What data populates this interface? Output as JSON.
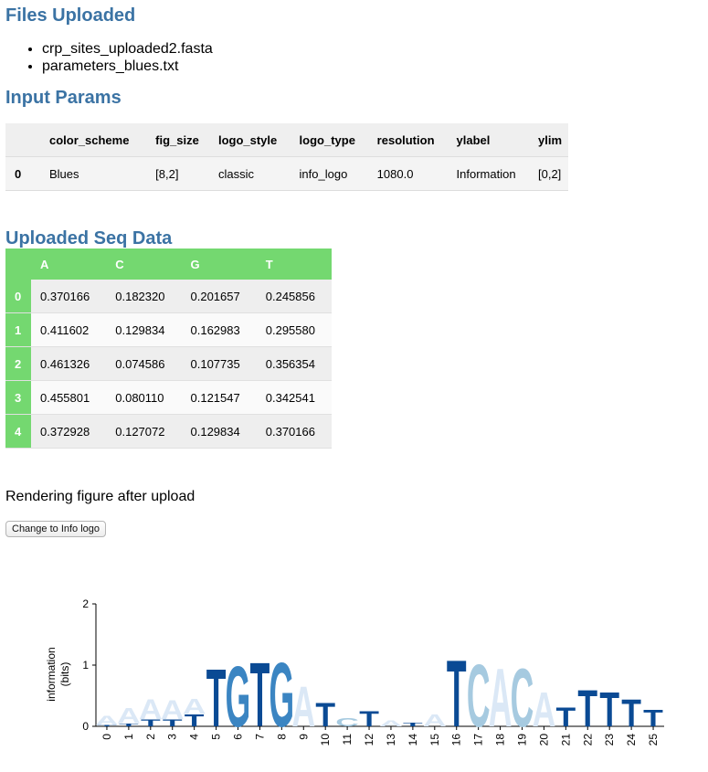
{
  "files": {
    "title": "Files Uploaded",
    "items": [
      "crp_sites_uploaded2.fasta",
      "parameters_blues.txt"
    ]
  },
  "params": {
    "title": "Input Params",
    "headers": [
      "",
      "color_scheme",
      "fig_size",
      "logo_style",
      "logo_type",
      "resolution",
      "ylabel",
      "ylim"
    ],
    "rows": [
      [
        "0",
        "Blues",
        "[8,2]",
        "classic",
        "info_logo",
        "1080.0",
        "Information",
        "[0,2]"
      ]
    ]
  },
  "seq": {
    "title": "Uploaded Seq Data",
    "headers": [
      "",
      "A",
      "C",
      "G",
      "T"
    ],
    "rows": [
      [
        "0",
        "0.370166",
        "0.182320",
        "0.201657",
        "0.245856"
      ],
      [
        "1",
        "0.411602",
        "0.129834",
        "0.162983",
        "0.295580"
      ],
      [
        "2",
        "0.461326",
        "0.074586",
        "0.107735",
        "0.356354"
      ],
      [
        "3",
        "0.455801",
        "0.080110",
        "0.121547",
        "0.342541"
      ],
      [
        "4",
        "0.372928",
        "0.127072",
        "0.129834",
        "0.370166"
      ]
    ]
  },
  "render_text": "Rendering figure after upload",
  "button_label": "Change to Info logo",
  "chart_data": {
    "type": "sequence-logo",
    "ylabel_lines": [
      "information",
      "(bits)"
    ],
    "ylim": [
      0,
      2
    ],
    "yticks": [
      "0",
      "1",
      "2"
    ],
    "positions": [
      "0",
      "1",
      "2",
      "3",
      "4",
      "5",
      "6",
      "7",
      "8",
      "9",
      "10",
      "11",
      "12",
      "13",
      "14",
      "15",
      "16",
      "17",
      "18",
      "19",
      "20",
      "21",
      "22",
      "23",
      "24",
      "25"
    ],
    "colors": {
      "A": "#dbe8f6",
      "C": "#a6cae0",
      "G": "#3b85c2",
      "T": "#0a4a94"
    },
    "columns": [
      [
        [
          "T",
          0.02
        ],
        [
          "A",
          0.16
        ]
      ],
      [
        [
          "T",
          0.05
        ],
        [
          "A",
          0.26
        ]
      ],
      [
        [
          "T",
          0.12
        ],
        [
          "A",
          0.34
        ]
      ],
      [
        [
          "T",
          0.12
        ],
        [
          "A",
          0.32
        ]
      ],
      [
        [
          "T",
          0.2
        ],
        [
          "A",
          0.26
        ]
      ],
      [
        [
          "T",
          0.97
        ]
      ],
      [
        [
          "G",
          1.02
        ]
      ],
      [
        [
          "T",
          1.08
        ]
      ],
      [
        [
          "G",
          1.08
        ]
      ],
      [
        [
          "A",
          0.68
        ]
      ],
      [
        [
          "T",
          0.4
        ]
      ],
      [
        [
          "C",
          0.14
        ]
      ],
      [
        [
          "T",
          0.26
        ]
      ],
      [
        [
          "A",
          0.1
        ]
      ],
      [
        [
          "T",
          0.06
        ]
      ],
      [
        [
          "A",
          0.2
        ]
      ],
      [
        [
          "T",
          1.12
        ]
      ],
      [
        [
          "C",
          1.05
        ]
      ],
      [
        [
          "A",
          0.98
        ]
      ],
      [
        [
          "C",
          0.98
        ]
      ],
      [
        [
          "A",
          0.58
        ]
      ],
      [
        [
          "T",
          0.32
        ]
      ],
      [
        [
          "T",
          0.62
        ]
      ],
      [
        [
          "T",
          0.58
        ]
      ],
      [
        [
          "T",
          0.46
        ]
      ],
      [
        [
          "T",
          0.28
        ]
      ]
    ]
  }
}
